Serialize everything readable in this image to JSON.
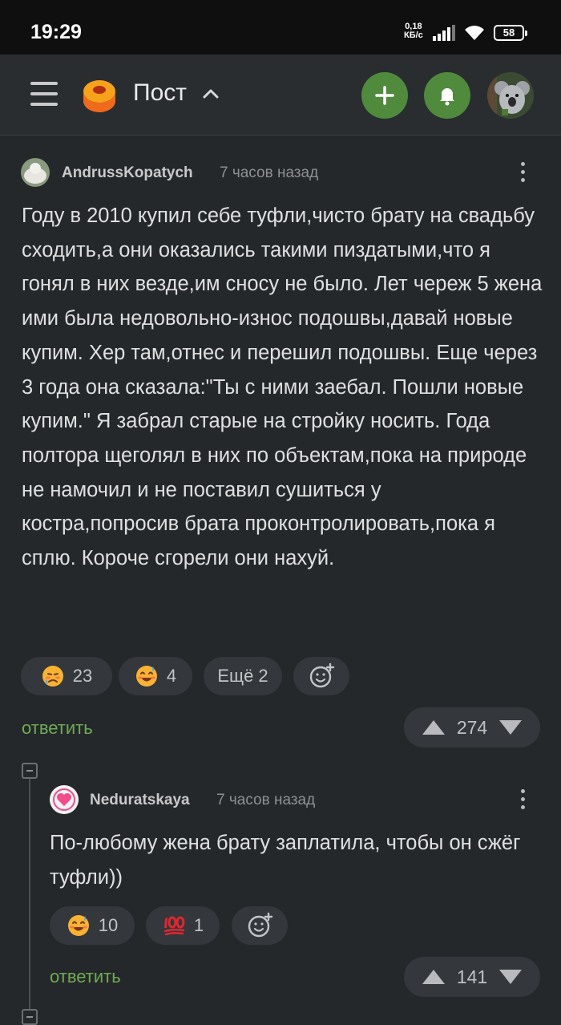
{
  "status_bar": {
    "time": "19:29",
    "speed_value": "0,18",
    "speed_unit": "КБ/с",
    "battery": "58"
  },
  "header": {
    "title": "Пост",
    "icons": [
      "menu-icon",
      "logo-icon",
      "chevron-up-icon",
      "plus-icon",
      "bell-icon",
      "avatar"
    ],
    "accent_color": "#4f8a3d"
  },
  "comments": [
    {
      "author": "AndrussKopatych",
      "time": "7 часов назад",
      "body": "Году в 2010 купил себе туфли,чисто брату на свадьбу сходить,а они оказались такими пиздатыми,что я гонял в них везде,им сносу не было. Лет череж 5 жена ими была недовольно-износ подошвы,давай новые купим. Хер там,отнес и перешил подошвы. Еще через 3 года она сказала:\"Ты с ними заебал. Пошли новые купим.\" Я забрал старые на стройку носить. Года полтора щеголял в них по объектам,пока на природе не намочил и не поставил сушиться у костра,попросив брата проконтролировать,пока я сплю. Короче сгорели они нахуй.",
      "reactions": [
        {
          "icon": "sad-sweat-emoji",
          "count": "23"
        },
        {
          "icon": "smiling-sweat-emoji",
          "count": "4"
        }
      ],
      "more_reactions": "Ещё 2",
      "reply_label": "ответить",
      "score": "274"
    },
    {
      "author": "Neduratskaya",
      "time": "7 часов назад",
      "body": "По-любому жена брату заплатила, чтобы он сжёг туфли))",
      "reactions": [
        {
          "icon": "smiling-sweat-emoji",
          "count": "10"
        },
        {
          "icon": "hundred-points-emoji",
          "count": "1"
        }
      ],
      "reply_label": "ответить",
      "score": "141"
    }
  ]
}
